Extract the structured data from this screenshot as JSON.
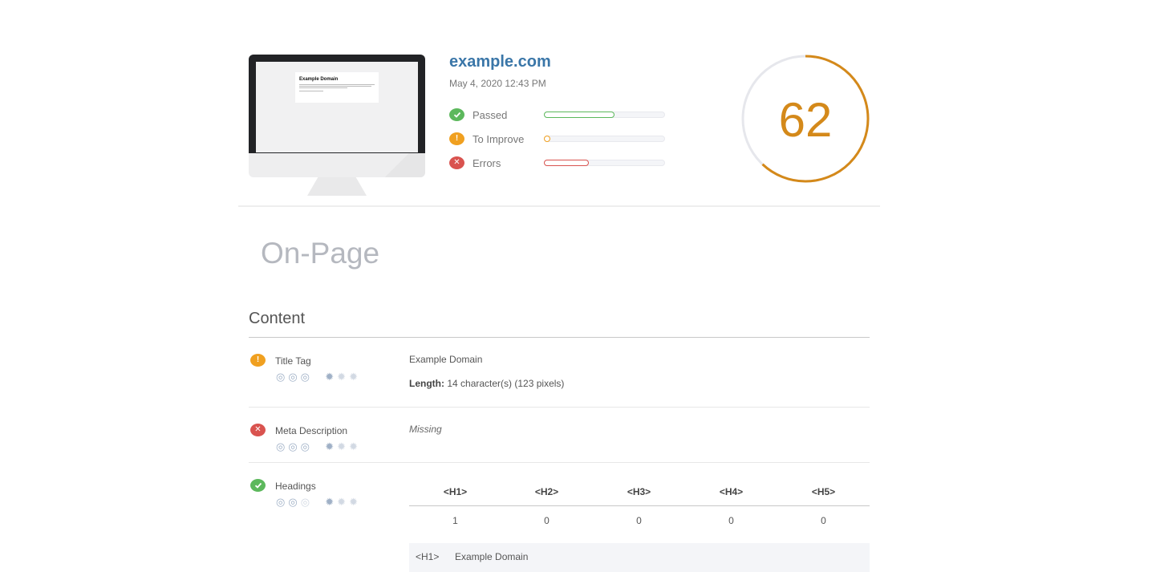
{
  "header": {
    "domain": "example.com",
    "date": "May 4, 2020 12:43 PM",
    "preview": {
      "title": "Example Domain"
    },
    "score": 62,
    "score_color": "#d4891a",
    "stats": [
      {
        "icon": "check-icon",
        "label": "Passed",
        "color": "#5cb85c",
        "progress": 0.58
      },
      {
        "icon": "exclamation-icon",
        "label": "To Improve",
        "color": "#f0a020",
        "progress": 0.05
      },
      {
        "icon": "x-icon",
        "label": "Errors",
        "color": "#d9534f",
        "progress": 0.37
      }
    ]
  },
  "section_title": "On-Page",
  "content": {
    "heading": "Content",
    "checks": [
      {
        "name": "Title Tag",
        "status": "warning",
        "value": "Example Domain",
        "length_label": "Length:",
        "length_value": "14 character(s) (123 pixels)"
      },
      {
        "name": "Meta Description",
        "status": "error",
        "value": "Missing"
      },
      {
        "name": "Headings",
        "status": "passed",
        "table": {
          "headers": [
            "<H1>",
            "<H2>",
            "<H3>",
            "<H4>",
            "<H5>"
          ],
          "counts": [
            "1",
            "0",
            "0",
            "0",
            "0"
          ],
          "list_tag": "<H1>",
          "list_text": "Example Domain"
        }
      }
    ]
  }
}
